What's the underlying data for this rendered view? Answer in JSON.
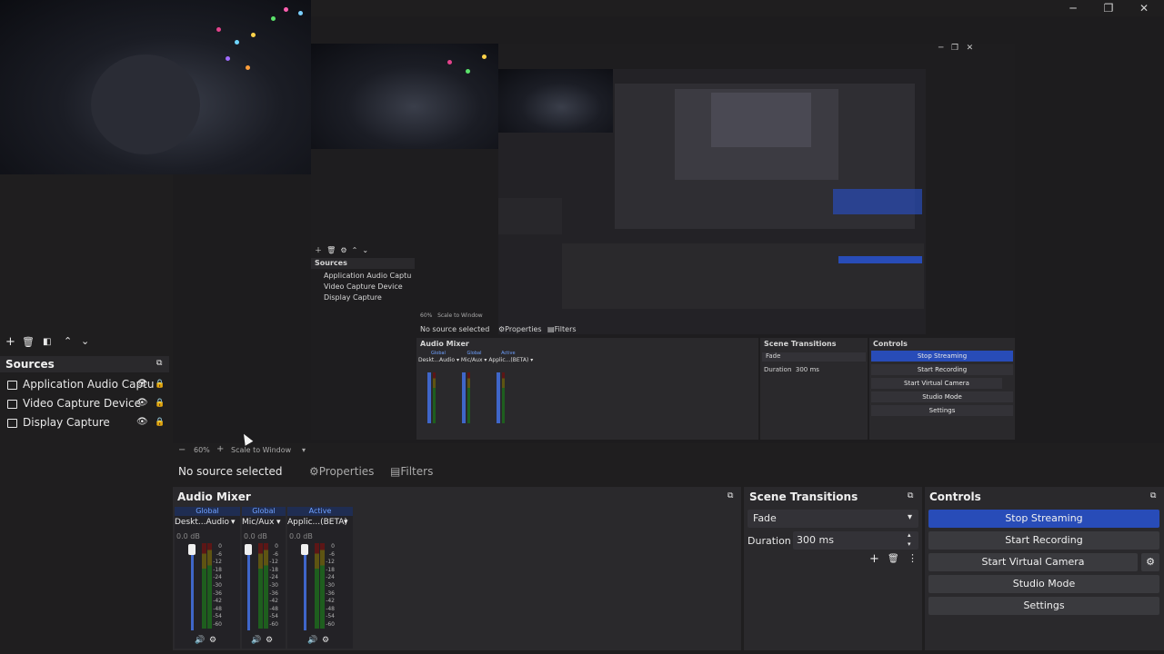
{
  "window": {
    "controls": {
      "minimize": "─",
      "maximize": "❐",
      "close": "✕"
    }
  },
  "preview": {
    "zoom": "60%",
    "scale_mode": "Scale to Window",
    "nested": {
      "sources_title": "Sources",
      "sources": [
        "Application Audio Captu",
        "Video Capture Device",
        "Display Capture"
      ],
      "no_source": "No source selected",
      "properties": "Properties",
      "filters": "Filters",
      "audio_mixer": "Audio Mixer",
      "scene_transitions": "Scene Transitions",
      "transition": "Fade",
      "duration_label": "Duration",
      "duration_value": "300 ms",
      "controls": "Controls",
      "buttons": [
        "Stop Streaming",
        "Start Recording",
        "Start Virtual Camera",
        "Studio Mode",
        "Settings"
      ],
      "mixer_global": "Global",
      "mixer_active": "Active",
      "channels": [
        "Deskt...Audio",
        "Mic/Aux",
        "Applic...(BETA)"
      ],
      "zoom": "60%",
      "scale_mode": "Scale to Window"
    }
  },
  "sources": {
    "title": "Sources",
    "items": [
      {
        "label": "Application Audio Captu"
      },
      {
        "label": "Video Capture Device"
      },
      {
        "label": "Display Capture"
      }
    ]
  },
  "context_bar": {
    "no_source": "No source selected",
    "properties": "Properties",
    "filters": "Filters"
  },
  "audio_mixer": {
    "title": "Audio Mixer",
    "channels": [
      {
        "header": "Global",
        "name": "Deskt...Audio",
        "db": "0.0 dB"
      },
      {
        "header": "Global",
        "name": "Mic/Aux",
        "db": "0.0 dB"
      },
      {
        "header": "Active",
        "name": "Applic...(BETA)",
        "db": "0.0 dB"
      }
    ],
    "scale": [
      "0",
      "-6",
      "-12",
      "-18",
      "-24",
      "-30",
      "-36",
      "-42",
      "-48",
      "-54",
      "-60"
    ]
  },
  "scene_transitions": {
    "title": "Scene Transitions",
    "transition": "Fade",
    "duration_label": "Duration",
    "duration_value": "300 ms"
  },
  "controls": {
    "title": "Controls",
    "stop_streaming": "Stop Streaming",
    "start_recording": "Start Recording",
    "start_virtual_camera": "Start Virtual Camera",
    "studio_mode": "Studio Mode",
    "settings": "Settings"
  },
  "colors": {
    "accent": "#284cb8",
    "panel": "#2a292c",
    "button": "#3a3a3e"
  }
}
